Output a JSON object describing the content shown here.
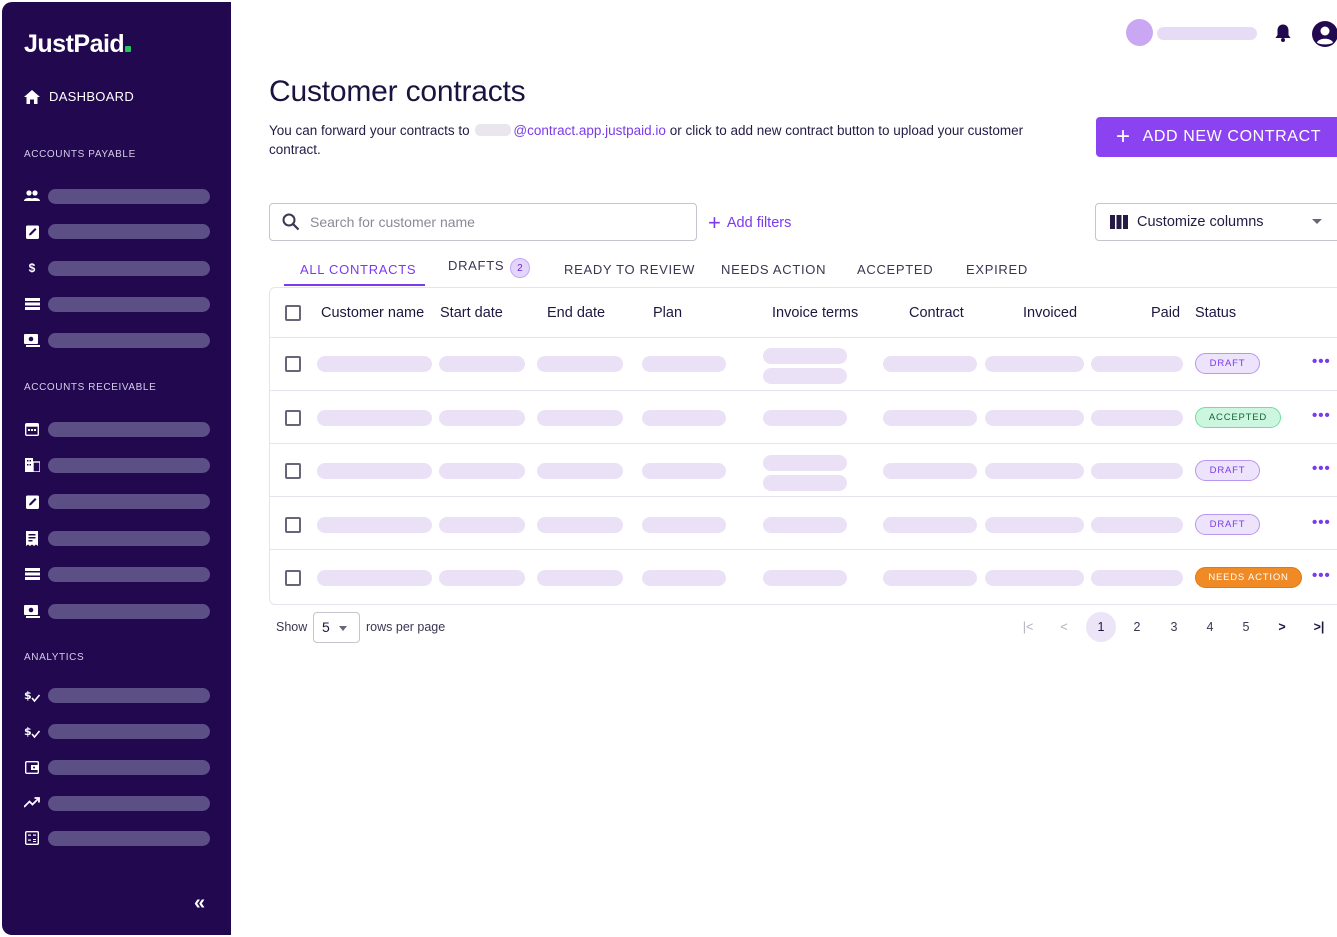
{
  "brand": {
    "name": "JustPaid",
    "accent": "#8b43f2",
    "dot_color": "#22c55e"
  },
  "sidebar": {
    "dashboard_label": "DASHBOARD",
    "sections": [
      {
        "label": "ACCOUNTS PAYABLE",
        "icons": [
          "people-icon",
          "clipboard-icon",
          "dollar-icon",
          "list-icon",
          "cash-icon"
        ]
      },
      {
        "label": "ACCOUNTS RECEIVABLE",
        "icons": [
          "calendar-icon",
          "building-icon",
          "clipboard-icon",
          "receipt-icon",
          "list-icon",
          "cash-icon"
        ]
      },
      {
        "label": "ANALYTICS",
        "icons": [
          "dollar-check-icon",
          "dollar-check-icon",
          "wallet-icon",
          "trend-up-icon",
          "calculator-icon"
        ]
      }
    ],
    "collapse_glyph": "«"
  },
  "page": {
    "title": "Customer contracts",
    "desc_before": "You can forward your contracts to",
    "desc_email": "@contract.app.justpaid.io",
    "desc_after": "or click to add new contract button to upload your customer contract.",
    "add_button": "ADD NEW CONTRACT"
  },
  "toolbar": {
    "search_placeholder": "Search for customer name",
    "add_filters": "Add filters",
    "customize_columns": "Customize columns"
  },
  "tabs": [
    {
      "label": "ALL CONTRACTS",
      "active": true
    },
    {
      "label": "DRAFTS",
      "badge": "2"
    },
    {
      "label": "READY TO REVIEW"
    },
    {
      "label": "NEEDS ACTION"
    },
    {
      "label": "ACCEPTED"
    },
    {
      "label": "EXPIRED"
    }
  ],
  "table": {
    "columns": [
      "Customer name",
      "Start date",
      "End date",
      "Plan",
      "Invoice terms",
      "Contract",
      "Invoiced",
      "Paid",
      "Status"
    ],
    "rows": [
      {
        "status": "DRAFT",
        "status_kind": "draft",
        "invoice_terms_lines": 2
      },
      {
        "status": "ACCEPTED",
        "status_kind": "accepted",
        "invoice_terms_lines": 1
      },
      {
        "status": "DRAFT",
        "status_kind": "draft",
        "invoice_terms_lines": 2
      },
      {
        "status": "DRAFT",
        "status_kind": "draft",
        "invoice_terms_lines": 1
      },
      {
        "status": "NEEDS ACTION",
        "status_kind": "needs",
        "invoice_terms_lines": 1
      }
    ],
    "more_glyph": "•••"
  },
  "pagination": {
    "show_label": "Show",
    "rows_per_page": "5",
    "rows_label": "rows per page",
    "pages": [
      "1",
      "2",
      "3",
      "4",
      "5"
    ],
    "current_page": "1",
    "first_glyph": "|<",
    "prev_glyph": "<",
    "next_glyph": ">",
    "last_glyph": ">|"
  }
}
